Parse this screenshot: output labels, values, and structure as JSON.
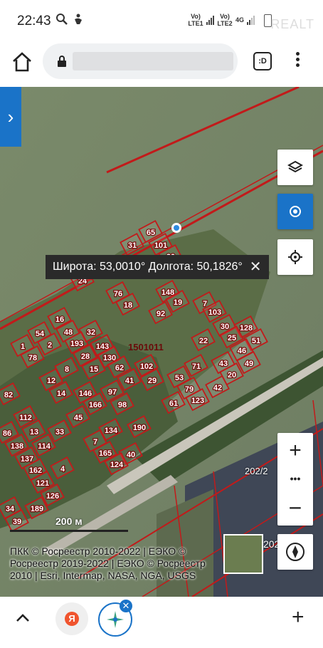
{
  "statusbar": {
    "time": "22:43",
    "net1": "Vo) LTE1",
    "net2": "Vo) LTE2",
    "net3": "4G",
    "watermark": "REALT"
  },
  "browser": {
    "tabs_count": ":D"
  },
  "map": {
    "coords_text": "Широта: 53,0010° Долгота: 50,1826°",
    "close_glyph": "✕",
    "cadastral_label": "1501011",
    "scale_text": "200 м",
    "attribution": "ПКК © Росреестр 2010-2022 | ЕЭКО © Росреестр 2019-2022 | ЕЭКО © Росреестр 2010 | Esri, Intermap, NASA, NGA, USGS",
    "zoom_in": "+",
    "zoom_more": "•••",
    "zoom_out": "−",
    "plot_label_202_2": "202/2",
    "plot_label_202": "202",
    "parcels": [
      {
        "n": "65"
      },
      {
        "n": "31"
      },
      {
        "n": "101"
      },
      {
        "n": "20"
      },
      {
        "n": "24"
      },
      {
        "n": "76"
      },
      {
        "n": "18"
      },
      {
        "n": "148"
      },
      {
        "n": "92"
      },
      {
        "n": "19"
      },
      {
        "n": "7"
      },
      {
        "n": "103"
      },
      {
        "n": "16"
      },
      {
        "n": "54"
      },
      {
        "n": "48"
      },
      {
        "n": "32"
      },
      {
        "n": "30"
      },
      {
        "n": "128"
      },
      {
        "n": "1"
      },
      {
        "n": "2"
      },
      {
        "n": "193"
      },
      {
        "n": "143"
      },
      {
        "n": "22"
      },
      {
        "n": "25"
      },
      {
        "n": "51"
      },
      {
        "n": "78"
      },
      {
        "n": "28"
      },
      {
        "n": "130"
      },
      {
        "n": "46"
      },
      {
        "n": "43"
      },
      {
        "n": "49"
      },
      {
        "n": "12"
      },
      {
        "n": "8"
      },
      {
        "n": "15"
      },
      {
        "n": "62"
      },
      {
        "n": "102"
      },
      {
        "n": "71"
      },
      {
        "n": "53"
      },
      {
        "n": "20"
      },
      {
        "n": "14"
      },
      {
        "n": "146"
      },
      {
        "n": "97"
      },
      {
        "n": "41"
      },
      {
        "n": "29"
      },
      {
        "n": "79"
      },
      {
        "n": "42"
      },
      {
        "n": "166"
      },
      {
        "n": "98"
      },
      {
        "n": "61"
      },
      {
        "n": "123"
      },
      {
        "n": "112"
      },
      {
        "n": "45"
      },
      {
        "n": "86"
      },
      {
        "n": "13"
      },
      {
        "n": "33"
      },
      {
        "n": "134"
      },
      {
        "n": "190"
      },
      {
        "n": "138"
      },
      {
        "n": "114"
      },
      {
        "n": "7"
      },
      {
        "n": "137"
      },
      {
        "n": "165"
      },
      {
        "n": "40"
      },
      {
        "n": "162"
      },
      {
        "n": "4"
      },
      {
        "n": "121"
      },
      {
        "n": "124"
      },
      {
        "n": "126"
      },
      {
        "n": "34"
      },
      {
        "n": "189"
      },
      {
        "n": "39"
      },
      {
        "n": "82"
      }
    ]
  }
}
